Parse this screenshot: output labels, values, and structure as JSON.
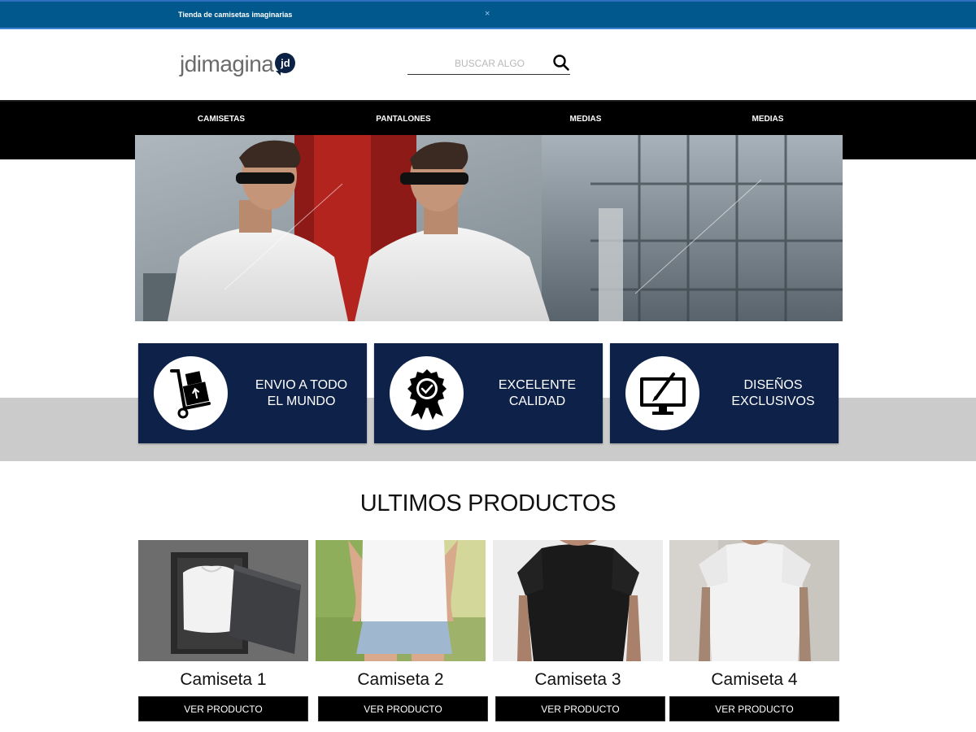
{
  "banner": {
    "text": "Tienda de camisetas imaginarias",
    "close_glyph": "×"
  },
  "logo": {
    "text": "jdimagina",
    "badge": "jd"
  },
  "search": {
    "placeholder": "BUSCAR ALGO"
  },
  "nav": {
    "items": [
      {
        "label": "CAMISETAS"
      },
      {
        "label": "PANTALONES"
      },
      {
        "label": "MEDIAS"
      },
      {
        "label": "MEDIAS"
      }
    ]
  },
  "features": [
    {
      "icon": "hand-truck-box-icon",
      "line1": "ENVIO A TODO",
      "line2": "EL MUNDO"
    },
    {
      "icon": "quality-badge-icon",
      "line1": "EXCELENTE",
      "line2": "CALIDAD"
    },
    {
      "icon": "monitor-pen-icon",
      "line1": "DISEÑOS",
      "line2": "EXCLUSIVOS"
    }
  ],
  "products": {
    "title": "ULTIMOS PRODUCTOS",
    "items": [
      {
        "name": "Camiseta 1",
        "button": "VER PRODUCTO"
      },
      {
        "name": "Camiseta 2",
        "button": "VER PRODUCTO"
      },
      {
        "name": "Camiseta 3",
        "button": "VER PRODUCTO"
      },
      {
        "name": "Camiseta 4",
        "button": "VER PRODUCTO"
      }
    ]
  },
  "colors": {
    "banner": "#00588c",
    "feature_bg": "#0d2149",
    "nav_bg": "#000000",
    "gray_band": "#cbcbcb"
  }
}
